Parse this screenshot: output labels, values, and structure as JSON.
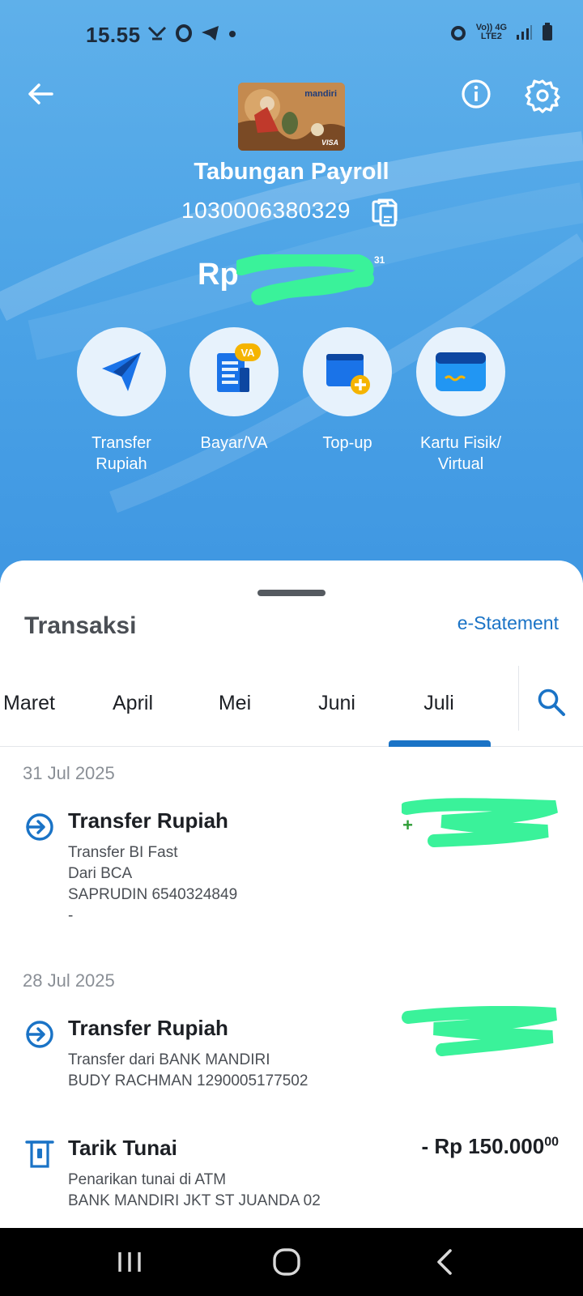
{
  "status_bar": {
    "time": "15.55",
    "network_top": "Vo)) 4G",
    "network_bottom": "LTE2"
  },
  "header": {
    "card_brand": "mandiri",
    "card_network": "VISA",
    "account_name": "Tabungan Payroll",
    "account_number": "1030006380329",
    "balance_currency": "Rp",
    "balance_superscript": "31"
  },
  "actions": [
    {
      "label": "Transfer\nRupiah",
      "icon": "paper-plane-icon"
    },
    {
      "label": "Bayar/VA",
      "icon": "document-va-icon",
      "badge": "VA"
    },
    {
      "label": "Top-up",
      "icon": "wallet-plus-icon"
    },
    {
      "label": "Kartu Fisik/\nVirtual",
      "icon": "card-icon"
    }
  ],
  "transactions_panel": {
    "title": "Transaksi",
    "estatement_link": "e-Statement",
    "months": [
      "Maret",
      "April",
      "Mei",
      "Juni",
      "Juli"
    ],
    "selected_month": "Juli",
    "groups": [
      {
        "date": "31 Jul 2025",
        "items": [
          {
            "title": "Transfer Rupiah",
            "lines": [
              "Transfer BI Fast",
              "Dari BCA",
              "SAPRUDIN 6540324849",
              "-"
            ],
            "amount_sign": "+",
            "amount_masked": true,
            "icon": "incoming-transfer-icon"
          }
        ]
      },
      {
        "date": "28 Jul 2025",
        "items": [
          {
            "title": "Transfer Rupiah",
            "lines": [
              "Transfer dari BANK MANDIRI",
              "BUDY RACHMAN 1290005177502"
            ],
            "amount_masked": true,
            "icon": "incoming-transfer-icon"
          },
          {
            "title": "Tarik Tunai",
            "lines": [
              "Penarikan tunai di ATM",
              "BANK MANDIRI JKT ST JUANDA 02"
            ],
            "amount": "- Rp 150.000",
            "amount_decimal": "00",
            "icon": "atm-withdraw-icon"
          }
        ]
      }
    ]
  },
  "colors": {
    "hero_blue": "#4aa2e6",
    "accent_blue": "#1a73c6",
    "credit_green": "#2e9d36",
    "mask_green": "#3af29a"
  }
}
